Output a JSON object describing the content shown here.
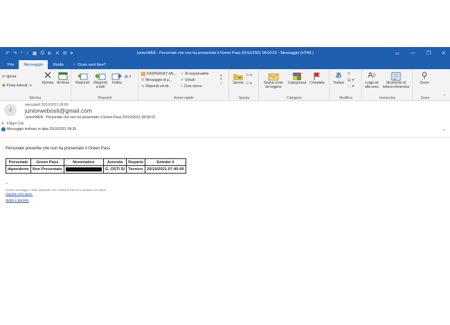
{
  "window": {
    "title": "JuniorWEB  - Personale che non ha presentato il Green Pass 20/10/2021 08:00:01  -  Messaggio (HTML)"
  },
  "tabs": [
    {
      "label": "File"
    },
    {
      "label": "Messaggio"
    },
    {
      "label": "Guida"
    }
  ],
  "tell_me": "Cosa vuoi fare?",
  "ribbon": {
    "elimina": {
      "ignora": "Ignora",
      "posta_indesid": "Posta indesid.",
      "elimina": "Elimina",
      "archivia": "Archivia",
      "label": "Elimina"
    },
    "rispondi": {
      "rispondi": "Rispondi",
      "rispondi_tutti_1": "Rispondi",
      "rispondi_tutti_2": "a tutti",
      "inoltra": "Inoltra",
      "label": "Rispondi"
    },
    "azioni_rapide": {
      "item1": "KASPERSKY AN...",
      "item2": "Messaggio di p...",
      "item3": "Rispondi ed eli...",
      "item4": "Al responsabile",
      "item5": "Chiudi",
      "item6": "Crea nuovo",
      "label": "Azioni rapide"
    },
    "sposta": {
      "sposta": "Sposta",
      "label": "Sposta"
    },
    "categorie": {
      "segna_1": "Segna come",
      "segna_2": "da leggere",
      "categorizza": "Categorizza",
      "completa": "Completa",
      "label": "Categorie"
    },
    "modifica": {
      "traduci": "Traduci",
      "label": "Modifica"
    },
    "immersiva": {
      "leggi_1": "Leggi ad",
      "leggi_2": "alta voce",
      "strumento_1": "Strumento di",
      "strumento_2": "lettura immersiva",
      "label": "Immersiva"
    },
    "zoom": {
      "zoom": "Zoom",
      "label": "Zoom"
    }
  },
  "message": {
    "avatar_initial": "J",
    "date": "mercoledì 20/10/2021 08:00",
    "from": "juniorwebosti@gmail.com",
    "subject": "JuniorWEB  - Personale che non ha presentato il Green Pass 20/10/2021 08:00:01",
    "to_prefix": "A",
    "to": "Filippo Osti",
    "info": "Messaggio inoltrato in data 20/10/2021 08:35.",
    "body_intro": "Personale presente che non ha presentato il Green Pass",
    "table": {
      "headers": [
        "Personale",
        "Green Pass",
        "Nominativo",
        "Azienda",
        "Reparto",
        "Entrato il"
      ],
      "row": [
        "dipendente",
        "Non Presentato",
        "",
        "G. OSTI SI",
        "Tecnico",
        "20/10/2021 07:45:00"
      ]
    },
    "dashes": "--",
    "scan_note": "Questo messaggio è stato analizzato con Libraesva ESG ed è risultato non infetto.",
    "link_spam": "Segnala come spam.",
    "link_blacklist": "Mettilo in blacklist."
  }
}
